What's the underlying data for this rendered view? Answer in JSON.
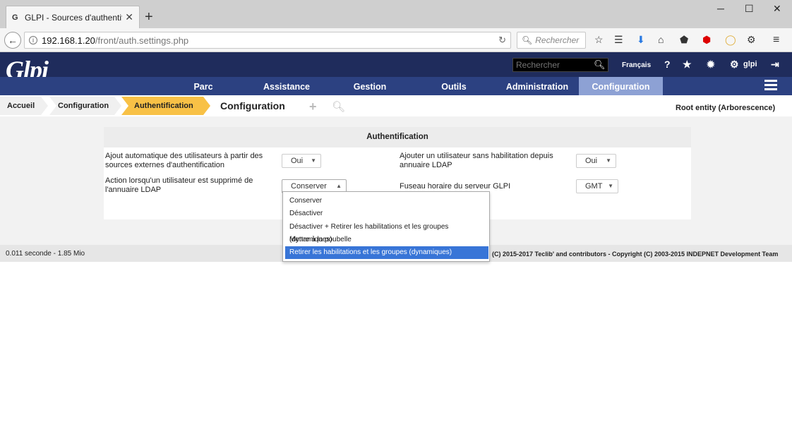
{
  "browser": {
    "tab_title": "GLPI - Sources d'authentifica",
    "tab_favicon": "G",
    "new_tab": "+",
    "url_host": "192.168.1.20",
    "url_path": "/front/auth.settings.php",
    "search_placeholder": "Rechercher",
    "window_controls": [
      "minimize-icon",
      "maximize-icon",
      "close-icon"
    ]
  },
  "glpi": {
    "logo": "Glpi",
    "search_placeholder": "Rechercher",
    "language": "Français",
    "username": "glpi",
    "menu": [
      "Parc",
      "Assistance",
      "Gestion",
      "Outils",
      "Administration",
      "Configuration"
    ],
    "active_menu": "Configuration"
  },
  "breadcrumb": {
    "items": [
      "Accueil",
      "Configuration",
      "Authentification"
    ],
    "title": "Configuration",
    "entity": "Root entity (Arborescence)"
  },
  "form": {
    "header": "Authentification",
    "auto_add_label": "Ajout automatique des utilisateurs à partir des sources externes d'authentification",
    "auto_add_value": "Oui",
    "add_no_rights_label": "Ajouter un utilisateur sans habilitation depuis annuaire LDAP",
    "add_no_rights_value": "Oui",
    "deleted_action_label": "Action lorsqu'un utilisateur est supprimé de l'annuaire LDAP",
    "deleted_action_value": "Conserver",
    "timezone_label": "Fuseau horaire du serveur GLPI",
    "timezone_value": "GMT",
    "dropdown_options": [
      "Conserver",
      "Désactiver",
      "Désactiver + Retirer les habilitations et les groupes (dynamiques)",
      "Mettre à la poubelle",
      "Retirer les habilitations et les groupes (dynamiques)"
    ],
    "highlighted_option": "Retirer les habilitations et les groupes (dynamiques)"
  },
  "footer": {
    "timing": "0.011 seconde - 1.85 Mio",
    "copyright": "(C) 2015-2017 Teclib' and contributors - Copyright (C) 2003-2015 INDEPNET Development Team"
  },
  "colors": {
    "header_dark": "#1f2c5c",
    "menu_bar": "#2c4181",
    "menu_active": "#8da1d4",
    "breadcrumb_active": "#f8c146",
    "highlight": "#3875d7"
  }
}
